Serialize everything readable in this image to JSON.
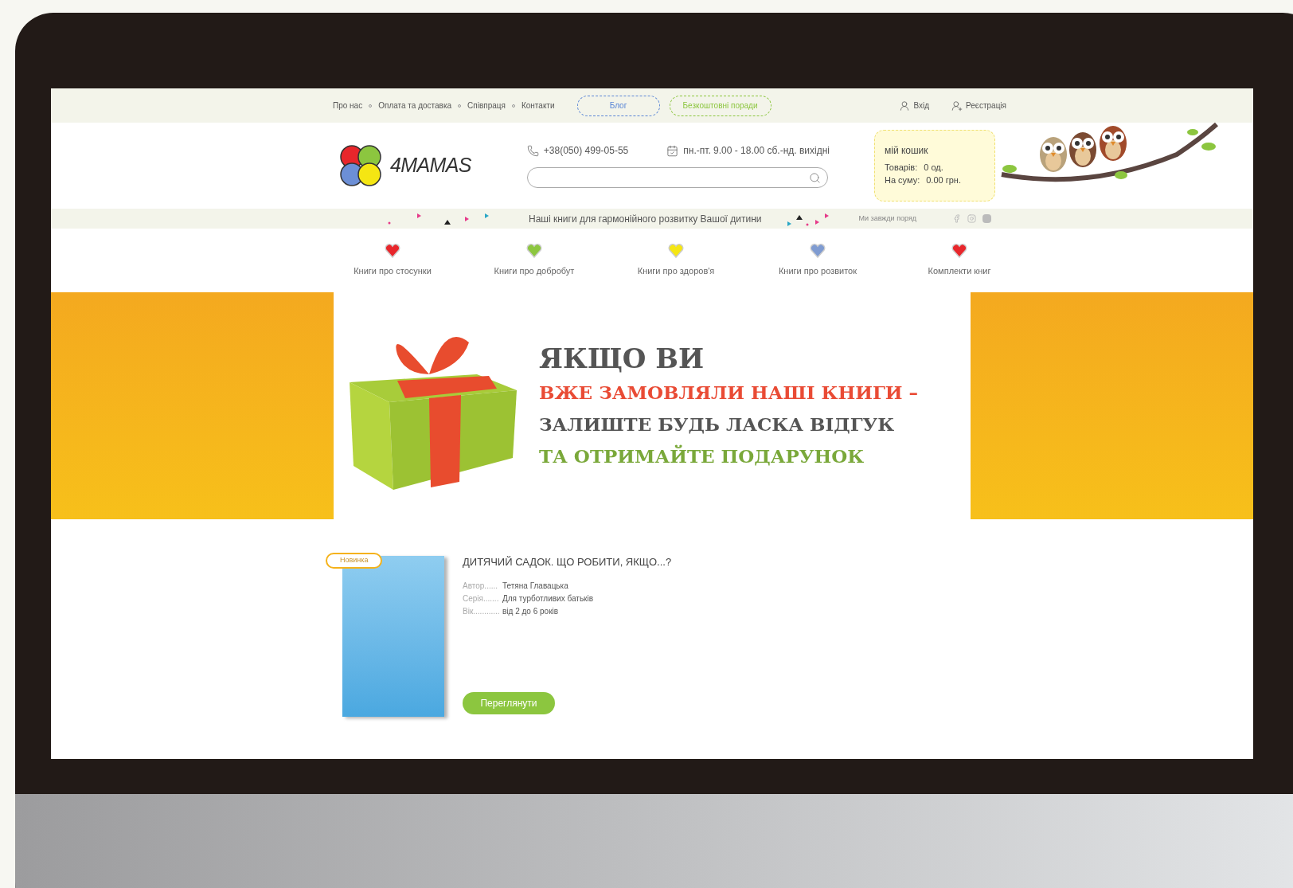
{
  "top_bar": {
    "links": [
      "Про нас",
      "Оплата та доставка",
      "Співпраця",
      "Контакти"
    ],
    "pill_buttons": [
      {
        "label": "Блог",
        "color": "#5b86d6"
      },
      {
        "label": "Безкоштовні поради",
        "color": "#8cc63f"
      }
    ],
    "account": [
      {
        "kind": "login",
        "label": "Вхід"
      },
      {
        "kind": "register",
        "label": "Реєстрація"
      }
    ]
  },
  "header": {
    "logo": "4MAMAS",
    "phone": "+38(050) 499-05-55",
    "hours": "пн.-пт. 9.00 - 18.00 сб.-нд. вихідні",
    "cart": {
      "title": "мій кошик",
      "rows": [
        {
          "label": "Товарів:",
          "value": "0 од."
        },
        {
          "label": "На суму:",
          "value": "0.00 грн."
        }
      ]
    }
  },
  "tagline": {
    "text": "Наші книги для гармонійного розвитку Вашої дитини",
    "note": "Ми завжди поряд"
  },
  "categories": [
    {
      "label": "Книги про стосунки",
      "color": "#e8262b"
    },
    {
      "label": "Книги про добробут",
      "color": "#8cc63f"
    },
    {
      "label": "Книги про здоров'я",
      "color": "#f5e613"
    },
    {
      "label": "Книги про розвиток",
      "color": "#7f9bd1"
    },
    {
      "label": "Комплекти книг",
      "color": "#e8262b"
    }
  ],
  "banner": {
    "lines": [
      {
        "text": "ЯКЩО ВИ",
        "color": "#555555"
      },
      {
        "text": "ВЖЕ ЗАМОВЛЯЛИ НАШІ КНИГИ –",
        "color": "#e94b35"
      },
      {
        "text": "ЗАЛИШТЕ БУДЬ ЛАСКА ВІДГУК",
        "color": "#555555"
      },
      {
        "text": "ТА ОТРИМАЙТЕ ПОДАРУНОК",
        "color": "#7aa83a"
      }
    ]
  },
  "product": {
    "badge": "Новинка",
    "title": "ДИТЯЧИЙ САДОК. ЩО РОБИТИ, ЯКЩО...?",
    "details": [
      {
        "label": "Автор......",
        "value": "Тетяна Главацька"
      },
      {
        "label": "Серія.......",
        "value": "Для турботливих батьків"
      },
      {
        "label": "Вік............",
        "value": "від 2 до 6 років"
      }
    ],
    "button": "Переглянути"
  }
}
